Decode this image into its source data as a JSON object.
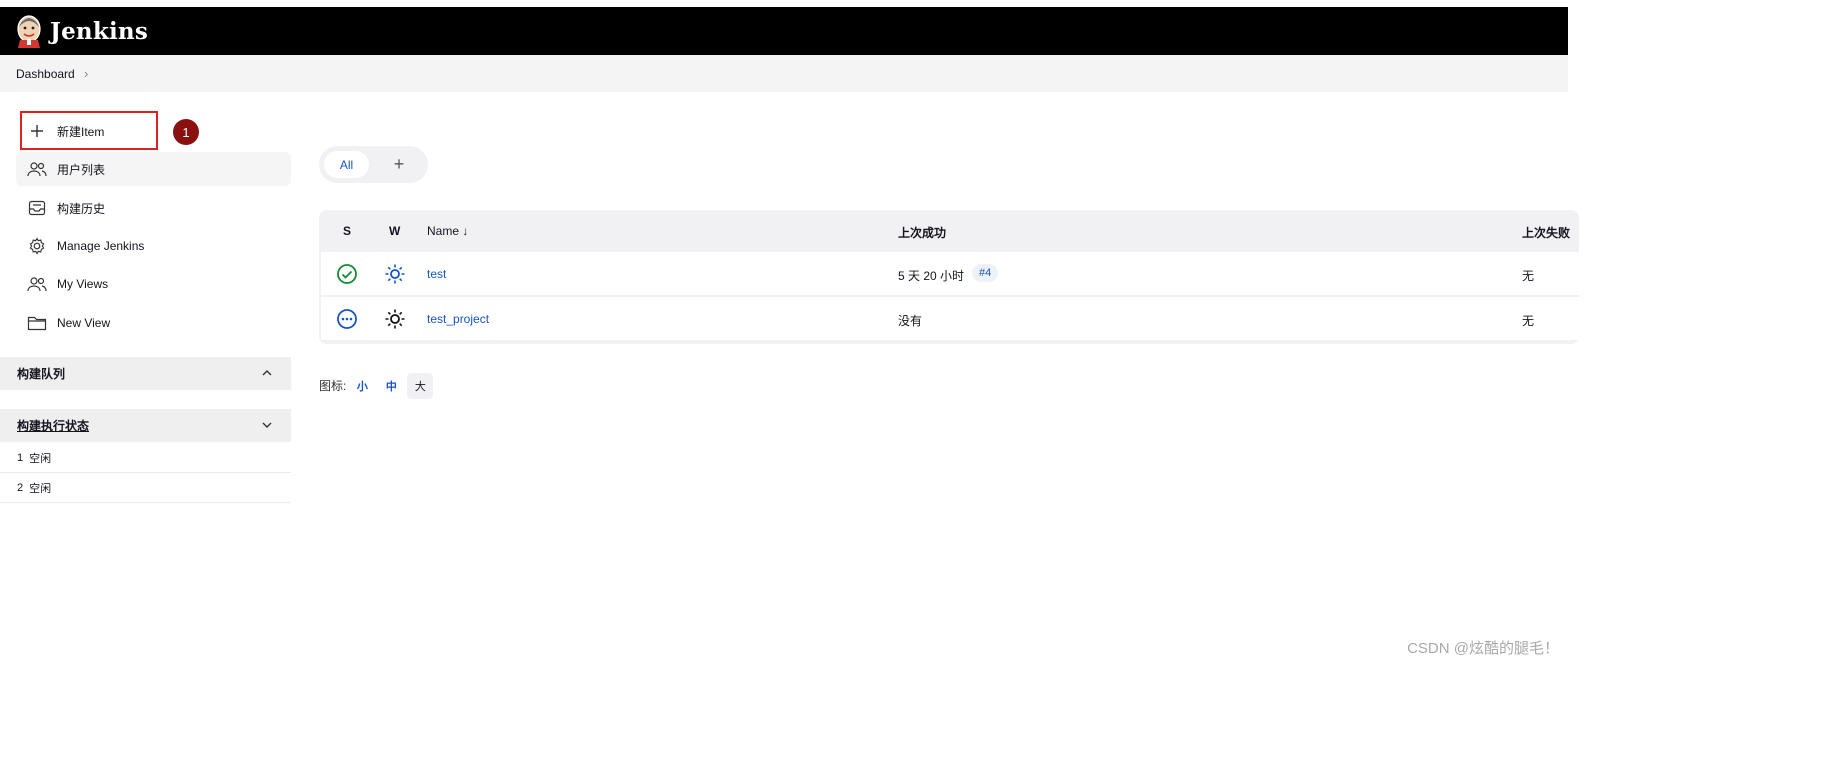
{
  "app": {
    "brand": "Jenkins"
  },
  "breadcrumb": {
    "home": "Dashboard",
    "separator": "›"
  },
  "sidebar": {
    "items": [
      {
        "label": "新建Item",
        "icon": "plus-icon"
      },
      {
        "label": "用户列表",
        "icon": "users-icon"
      },
      {
        "label": "构建历史",
        "icon": "history-inbox-icon"
      },
      {
        "label": "Manage Jenkins",
        "icon": "gear-icon"
      },
      {
        "label": "My Views",
        "icon": "people-icon"
      },
      {
        "label": "New View",
        "icon": "folder-icon"
      }
    ],
    "step_badge": "1"
  },
  "build_queue": {
    "title": "构建队列",
    "chevron": "up"
  },
  "executors": {
    "title": "构建执行状态",
    "rows": [
      {
        "number": "1",
        "status": "空闲"
      },
      {
        "number": "2",
        "status": "空闲"
      }
    ]
  },
  "tabs": {
    "all": "All",
    "add": "+"
  },
  "table": {
    "headers": {
      "s": "S",
      "w": "W",
      "name": "Name ↓",
      "last_success": "上次成功",
      "last_failure": "上次失败"
    },
    "rows": [
      {
        "status_icon": "success-check-icon",
        "weather_icon": "sunny-icon",
        "name": "test",
        "last_success": "5 天 20 小时",
        "build": "#4",
        "last_failure": "无"
      },
      {
        "status_icon": "not-built-icon",
        "weather_icon": "sunny-icon",
        "name": "test_project",
        "last_success": "没有",
        "build": "",
        "last_failure": "无"
      }
    ]
  },
  "icon_size": {
    "label": "图标:",
    "small": "小",
    "medium": "中",
    "large": "大",
    "selected": "大"
  },
  "watermark": "CSDN @炫酷的腿毛！",
  "colors": {
    "link": "#1754c2",
    "success": "#138a36",
    "header_bg": "#000000",
    "highlight_box": "#e02020",
    "badge": "#8b1111"
  }
}
